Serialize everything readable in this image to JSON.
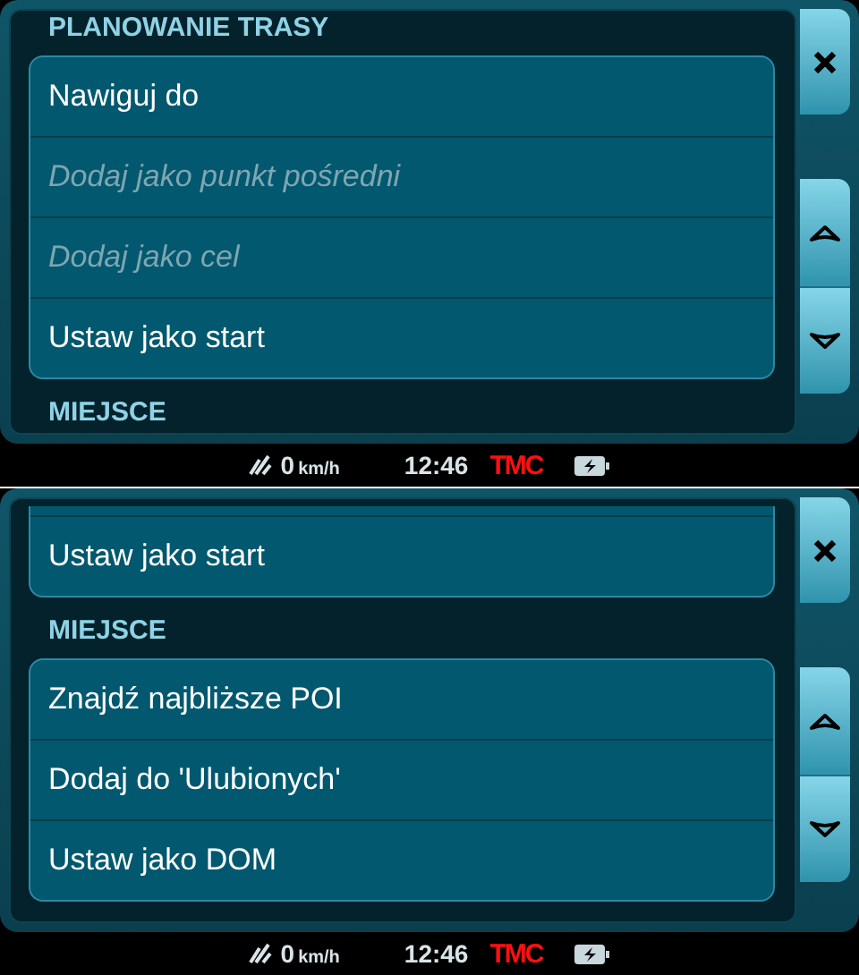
{
  "screens": [
    {
      "blocks": [
        {
          "kind": "header",
          "text": "PLANOWANIE TRASY"
        },
        {
          "kind": "card",
          "cut_top": false,
          "items": [
            {
              "label": "Nawiguj do",
              "disabled": false
            },
            {
              "label": "Dodaj jako punkt pośredni",
              "disabled": true
            },
            {
              "label": "Dodaj jako cel",
              "disabled": true
            },
            {
              "label": "Ustaw jako start",
              "disabled": false
            }
          ]
        },
        {
          "kind": "header",
          "text": "MIEJSCE"
        }
      ],
      "status": {
        "speed": "0",
        "unit": "km/h",
        "time": "12:46",
        "tmc": "TMC"
      }
    },
    {
      "blocks": [
        {
          "kind": "card",
          "cut_top": true,
          "items": [
            {
              "label": "Ustaw jako start",
              "disabled": false
            }
          ]
        },
        {
          "kind": "header",
          "text": "MIEJSCE"
        },
        {
          "kind": "card",
          "cut_top": false,
          "items": [
            {
              "label": "Znajdź najbliższe POI",
              "disabled": false
            },
            {
              "label": "Dodaj do 'Ulubionych'",
              "disabled": false
            },
            {
              "label": "Ustaw jako DOM",
              "disabled": false
            }
          ]
        }
      ],
      "status": {
        "speed": "0",
        "unit": "km/h",
        "time": "12:46",
        "tmc": "TMC"
      }
    }
  ]
}
